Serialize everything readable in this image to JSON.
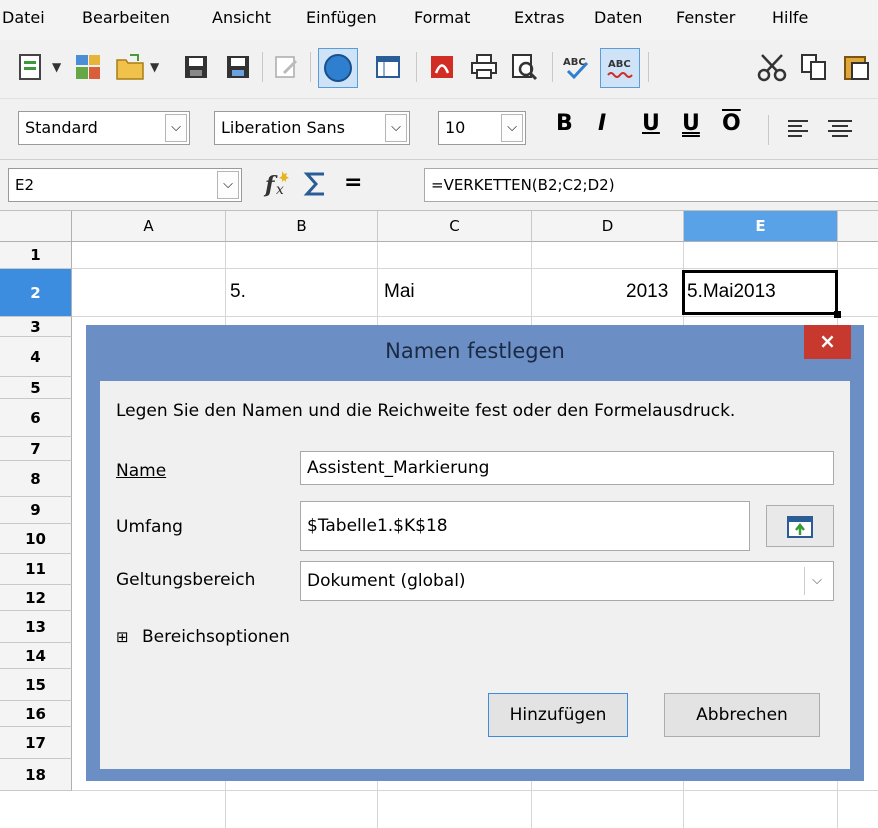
{
  "menubar": {
    "items": [
      "Datei",
      "Bearbeiten",
      "Ansicht",
      "Einfügen",
      "Format",
      "Extras",
      "Daten",
      "Fenster",
      "Hilfe"
    ]
  },
  "toolbar": {
    "style_value": "Standard",
    "font_value": "Liberation Sans",
    "size_value": "10",
    "bold_label": "B",
    "italic_label": "I",
    "underline_label": "U",
    "double_underline_label": "U",
    "overline_label": "O"
  },
  "formula_bar": {
    "cell_ref": "E2",
    "formula": "=VERKETTEN(B2;C2;D2)",
    "equals_label": "="
  },
  "sheet": {
    "columns": [
      "A",
      "B",
      "C",
      "D",
      "E"
    ],
    "rows": [
      "1",
      "2",
      "3",
      "4",
      "5",
      "6",
      "7",
      "8",
      "9",
      "10",
      "11",
      "12",
      "13",
      "14",
      "15",
      "16",
      "17",
      "18"
    ],
    "cells": {
      "B2": "5.",
      "C2": "Mai",
      "D2": "2013",
      "E2": "5.Mai2013"
    }
  },
  "dialog": {
    "title": "Namen festlegen",
    "close_label": "×",
    "description": "Legen Sie den Namen und die Reichweite fest oder den Formelausdruck.",
    "name_label": "Name",
    "name_value": "Assistent_Markierung",
    "range_label": "Umfang",
    "range_value": "$Tabelle1.$K$18",
    "scope_label": "Geltungsbereich",
    "scope_value": "Dokument (global)",
    "options_label": "Bereichsoptionen",
    "expand_symbol": "⊞",
    "add_button": "Hinzufügen",
    "cancel_button": "Abbrechen"
  },
  "colors": {
    "dialog_frame": "#6b8fc5",
    "close_button": "#c7392f",
    "selected_header": "#3c8de0",
    "selected_column_header": "#5aa2e8"
  }
}
